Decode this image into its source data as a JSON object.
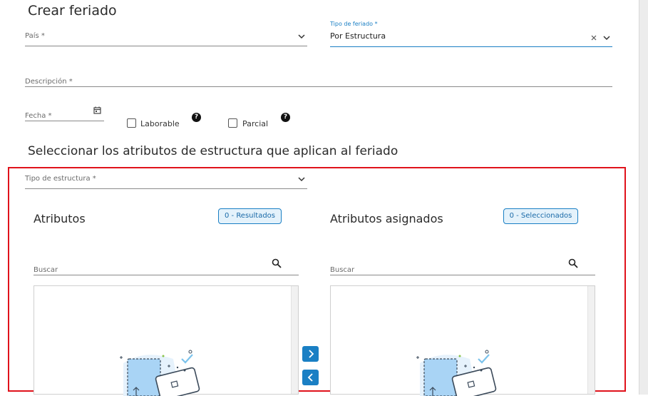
{
  "page": {
    "title": "Crear feriado",
    "section_title": "Seleccionar los atributos de estructura que aplican al feriado"
  },
  "form": {
    "pais": {
      "placeholder": "País *"
    },
    "tipo_feriado": {
      "label": "Tipo de feriado *",
      "value": "Por Estructura"
    },
    "descripcion": {
      "placeholder": "Descripción *"
    },
    "fecha": {
      "placeholder": "Fecha *"
    },
    "laborable": {
      "label": "Laborable",
      "checked": false
    },
    "parcial": {
      "label": "Parcial",
      "checked": false
    },
    "help_glyph": "?"
  },
  "estructura": {
    "placeholder": "Tipo de estructura *"
  },
  "atributos": {
    "title": "Atributos",
    "badge": "0 - Resultados",
    "search_placeholder": "Buscar"
  },
  "asignados": {
    "title": "Atributos asignados",
    "badge": "0 - Seleccionados",
    "search_placeholder": "Buscar"
  },
  "colors": {
    "accent": "#1a7fc4",
    "highlight": "#e0121b",
    "badge_bg": "#e4f2fb"
  },
  "icons": [
    "chevron-down-icon",
    "clear-icon",
    "calendar-icon",
    "help-icon",
    "search-icon",
    "arrow-right-icon",
    "arrow-left-icon",
    "empty-list-illustration"
  ]
}
